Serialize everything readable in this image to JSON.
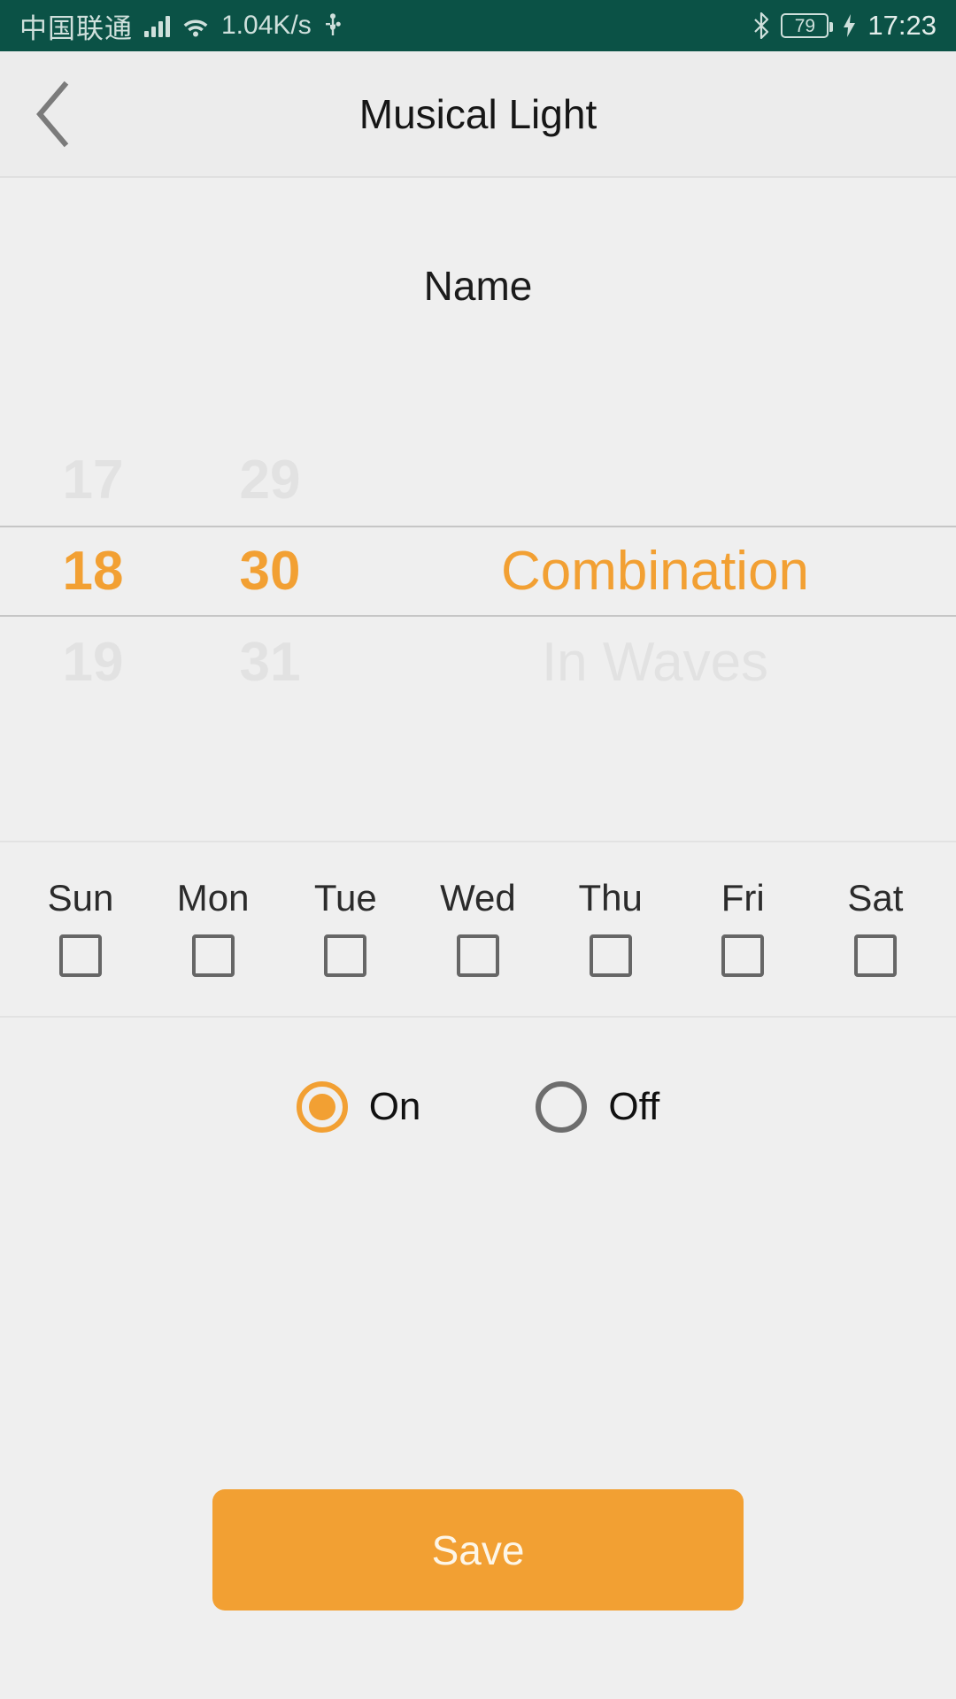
{
  "status_bar": {
    "carrier": "中国联通",
    "network_speed": "1.04K/s",
    "battery_level": "79",
    "time": "17:23",
    "icons": {
      "signal": "signal-bars-icon",
      "wifi": "wifi-icon",
      "usb": "usb-icon",
      "bluetooth": "bluetooth-icon",
      "charging": "charging-bolt-icon"
    },
    "background_color": "#0b5246",
    "foreground_color": "#cfe0dc"
  },
  "app_bar": {
    "title": "Musical Light",
    "back_icon": "chevron-left-icon"
  },
  "form": {
    "name_label": "Name"
  },
  "picker": {
    "hour": {
      "prev": "17",
      "current": "18",
      "next": "19"
    },
    "minute": {
      "prev": "29",
      "current": "30",
      "next": "31"
    },
    "mode": {
      "prev": "",
      "current": "Combination",
      "next": "In Waves"
    },
    "selected_color": "#f2a033",
    "dim_color": "#e2e2e2"
  },
  "weekdays": [
    {
      "label": "Sun",
      "checked": false
    },
    {
      "label": "Mon",
      "checked": false
    },
    {
      "label": "Tue",
      "checked": false
    },
    {
      "label": "Wed",
      "checked": false
    },
    {
      "label": "Thu",
      "checked": false
    },
    {
      "label": "Fri",
      "checked": false
    },
    {
      "label": "Sat",
      "checked": false
    }
  ],
  "power": {
    "options": [
      {
        "label": "On",
        "selected": true
      },
      {
        "label": "Off",
        "selected": false
      }
    ]
  },
  "actions": {
    "save_label": "Save",
    "save_color": "#f2a033"
  }
}
